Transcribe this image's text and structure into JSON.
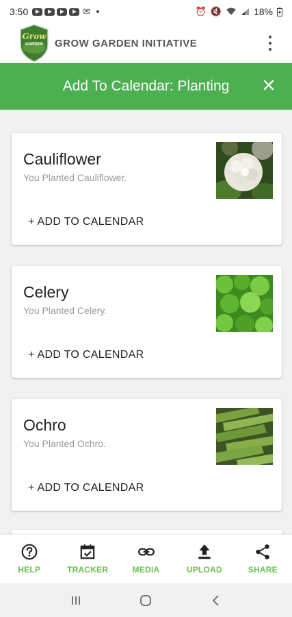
{
  "status_bar": {
    "time": "3:50",
    "battery": "18%"
  },
  "header": {
    "logo_text": "Grow",
    "logo_sub": "GARDEN",
    "title": "GROW GARDEN INITIATIVE"
  },
  "title_bar": {
    "title": "Add To Calendar: Planting"
  },
  "cards": [
    {
      "name": "Cauliflower",
      "subtitle": "You Planted Cauliflower.",
      "action": "+ ADD TO CALENDAR",
      "image": "cauliflower"
    },
    {
      "name": "Celery",
      "subtitle": "You Planted Celery.",
      "action": "+ ADD TO CALENDAR",
      "image": "celery"
    },
    {
      "name": "Ochro",
      "subtitle": "You Planted Ochro.",
      "action": "+ ADD TO CALENDAR",
      "image": "okra"
    }
  ],
  "bottom_nav": [
    {
      "label": "HELP",
      "icon": "help-icon"
    },
    {
      "label": "TRACKER",
      "icon": "calendar-check-icon"
    },
    {
      "label": "MEDIA",
      "icon": "link-icon"
    },
    {
      "label": "UPLOAD",
      "icon": "upload-icon"
    },
    {
      "label": "SHARE",
      "icon": "share-icon"
    }
  ],
  "colors": {
    "accent_green": "#4caf50",
    "nav_label_green": "#6abf4b",
    "header_text": "#555555"
  }
}
